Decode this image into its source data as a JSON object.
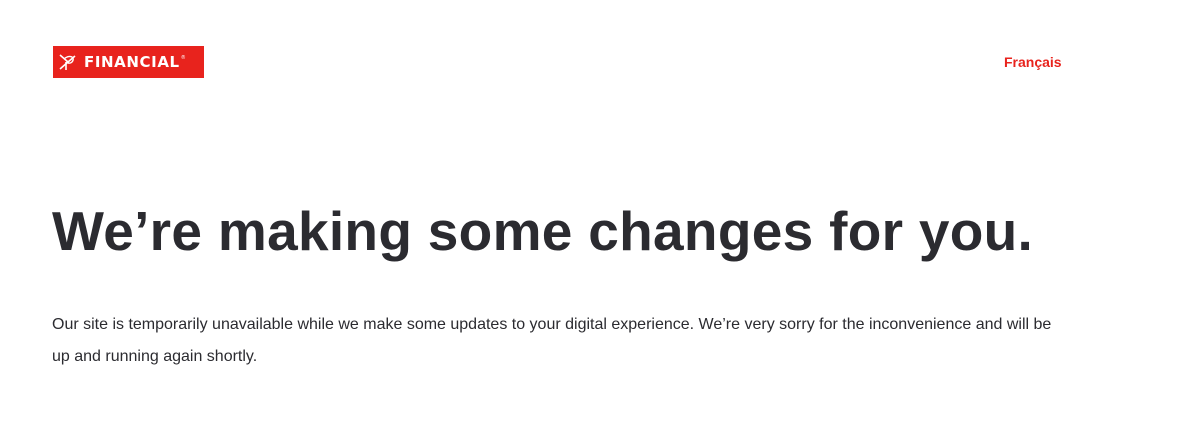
{
  "header": {
    "logo": {
      "text": "FINANCIAL",
      "reg_mark": "®",
      "icon": "flying-p-logo-icon",
      "brand_color": "#e8231d"
    },
    "language_link": "Français",
    "link_color": "#e8231d"
  },
  "main": {
    "headline": "We’re making some changes for you.",
    "message": "Our site is temporarily unavailable while we make some updates to your digital experience. We’re very sorry for the inconvenience and will be up and running again shortly.",
    "text_color": "#2b2b30"
  }
}
